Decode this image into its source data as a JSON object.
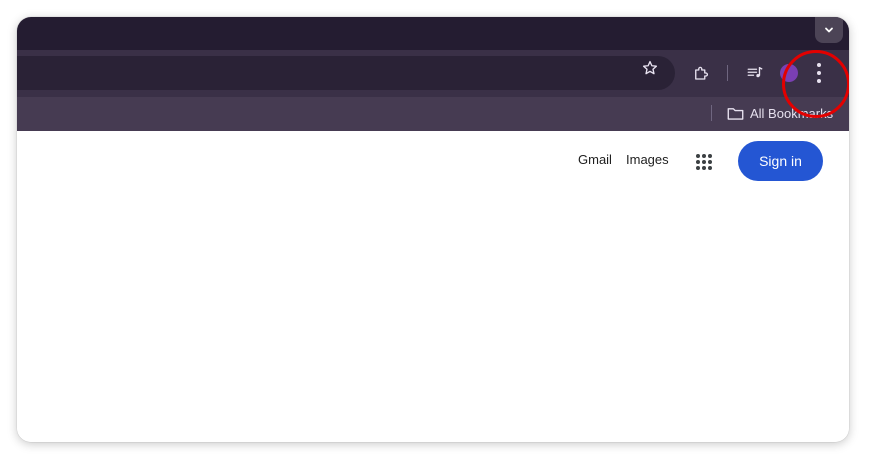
{
  "browser": {
    "toolbar": {
      "icons": [
        "bookmark-star-icon",
        "extensions-puzzle-icon",
        "media-controls-icon",
        "profile-avatar",
        "more-vertical-icon"
      ]
    },
    "bookmarks_bar": {
      "all_bookmarks_label": "All Bookmarks"
    }
  },
  "page": {
    "header": {
      "gmail_label": "Gmail",
      "images_label": "Images",
      "signin_label": "Sign in"
    }
  },
  "colors": {
    "tabstrip": "#241c31",
    "toolbar": "#3a3047",
    "bookmarks_bar": "#463b52",
    "signin_button": "#2456d3",
    "annotation": "#e30000"
  }
}
